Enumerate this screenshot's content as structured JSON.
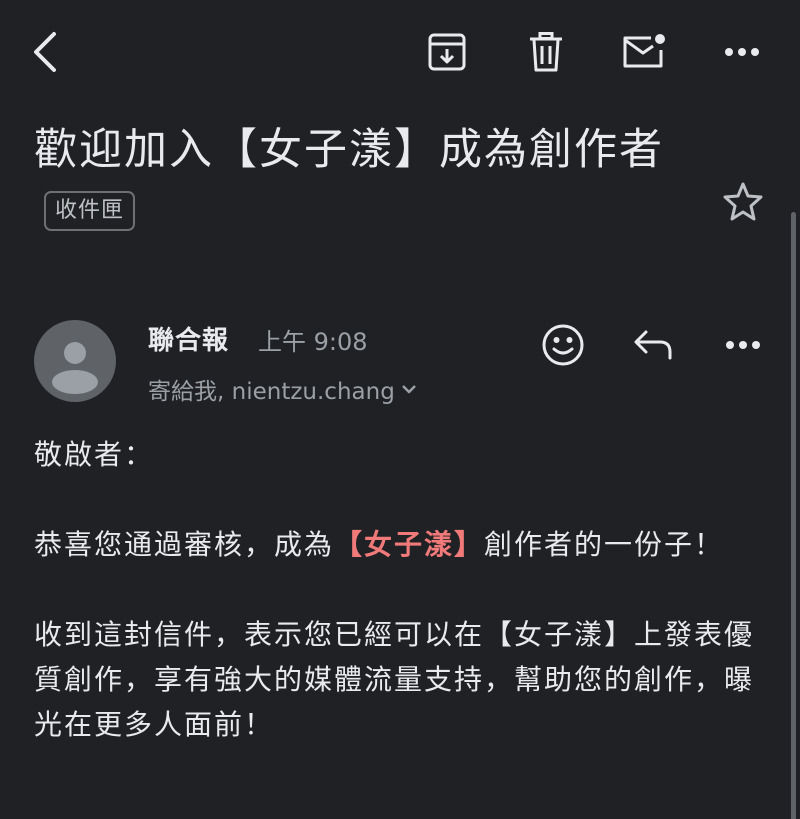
{
  "toolbar": {
    "back_icon": "arrow-left-icon",
    "archive_icon": "archive-icon",
    "delete_icon": "trash-icon",
    "unread_icon": "mark-unread-icon",
    "more_icon": "more-horizontal-icon"
  },
  "email": {
    "subject": "歡迎加入【女子漾】成為創作者",
    "label": "收件匣",
    "starred": false
  },
  "sender": {
    "name": "聯合報",
    "time": "上午 9:08",
    "recipients": "寄給我, nientzu.chang"
  },
  "body": {
    "greeting": "敬啟者：",
    "p1_before": "恭喜您通過審核，成為",
    "p1_highlight": "【女子漾】",
    "p1_after": "創作者的一份子！",
    "p2": "收到這封信件，表示您已經可以在【女子漾】上發表優質創作，享有強大的媒體流量支持，幫助您的創作，曝光在更多人面前！"
  },
  "colors": {
    "background": "#202124",
    "text": "#e8eaed",
    "muted": "#9aa0a6",
    "highlight": "#f07a7a"
  }
}
